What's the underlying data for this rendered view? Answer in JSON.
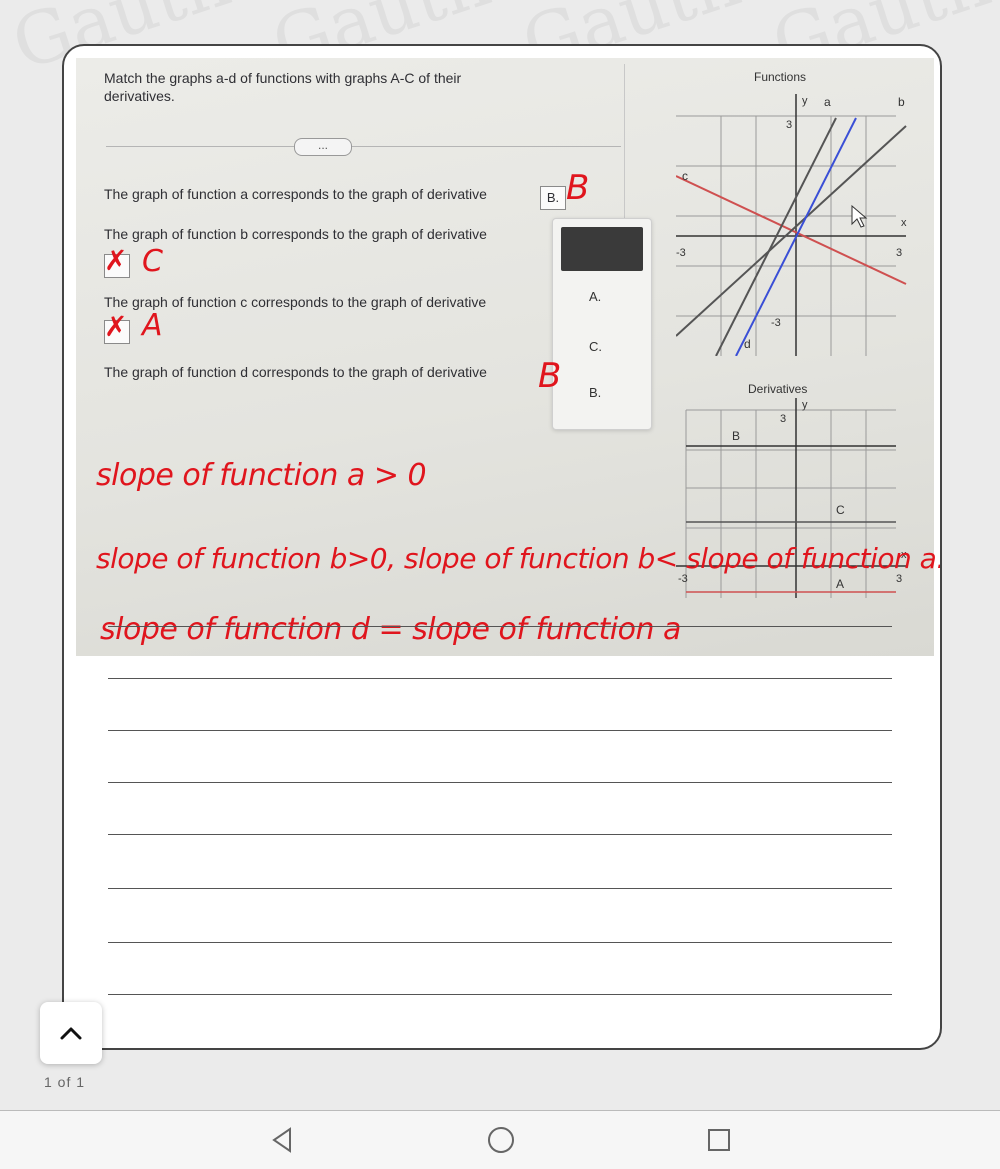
{
  "watermark_text": "Gauth",
  "question": {
    "prompt_line1": "Match the graphs a-d of functions with graphs A-C of their",
    "prompt_line2": "derivatives.",
    "more_label": "...",
    "item_a": "The graph of function a corresponds to the graph of derivative",
    "item_a_answer": "B.",
    "item_b": "The graph of function b corresponds to the graph of derivative",
    "item_c": "The graph of function c corresponds to the graph of derivative",
    "item_d": "The graph of function d corresponds to the graph of derivative"
  },
  "dropdown": {
    "options": [
      "A.",
      "C.",
      "B."
    ]
  },
  "functions_graph": {
    "title": "Functions",
    "y_axis": "y",
    "x_axis": "x",
    "label_a": "a",
    "label_b": "b",
    "label_c": "c",
    "label_d": "d",
    "tick_top": "3",
    "tick_left": "-3",
    "tick_right": "3",
    "tick_bottom": "-3"
  },
  "derivatives_graph": {
    "title": "Derivatives",
    "y_axis": "y",
    "x_axis": "x",
    "label_B": "B",
    "label_C": "C",
    "label_A": "A",
    "tick_top": "3",
    "tick_left": "-3",
    "tick_right": "3"
  },
  "handwriting": {
    "ans_a": "B",
    "mark_b": "✗",
    "ans_b": "C",
    "mark_c": "✗",
    "ans_c": "A",
    "ans_d": "B",
    "note1": "slope of function a > 0",
    "note2": "slope of function b>0, slope of function b< slope of function a.",
    "note3": "slope of function d = slope of function a"
  },
  "colors": {
    "handwriting": "#e0151d",
    "line_blue": "#3a4fd6",
    "line_red": "#cf5050",
    "line_gray": "#555555"
  },
  "pager": {
    "text": "1  of  1"
  },
  "nav": {
    "back_icon": "triangle-back-icon",
    "home_icon": "circle-home-icon",
    "recents_icon": "square-recents-icon"
  }
}
